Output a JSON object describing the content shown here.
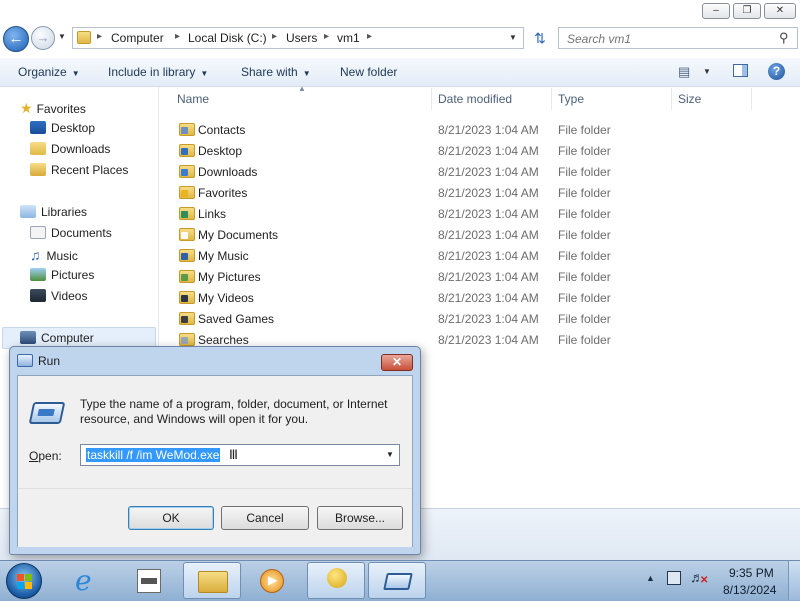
{
  "explorer": {
    "breadcrumb": [
      "Computer",
      "Local Disk (C:)",
      "Users",
      "vm1"
    ],
    "search_placeholder": "Search vm1",
    "toolbar": {
      "organize": "Organize",
      "include_in_library": "Include in library",
      "share_with": "Share with",
      "new_folder": "New folder"
    },
    "nav": {
      "favorites": "Favorites",
      "desktop": "Desktop",
      "downloads": "Downloads",
      "recent_places": "Recent Places",
      "libraries": "Libraries",
      "documents": "Documents",
      "music": "Music",
      "pictures": "Pictures",
      "videos": "Videos",
      "computer": "Computer"
    },
    "columns": {
      "name": "Name",
      "date_modified": "Date modified",
      "type": "Type",
      "size": "Size"
    },
    "files": [
      {
        "name": "Contacts",
        "date": "8/21/2023 1:04 AM",
        "type": "File folder"
      },
      {
        "name": "Desktop",
        "date": "8/21/2023 1:04 AM",
        "type": "File folder"
      },
      {
        "name": "Downloads",
        "date": "8/21/2023 1:04 AM",
        "type": "File folder"
      },
      {
        "name": "Favorites",
        "date": "8/21/2023 1:04 AM",
        "type": "File folder"
      },
      {
        "name": "Links",
        "date": "8/21/2023 1:04 AM",
        "type": "File folder"
      },
      {
        "name": "My Documents",
        "date": "8/21/2023 1:04 AM",
        "type": "File folder"
      },
      {
        "name": "My Music",
        "date": "8/21/2023 1:04 AM",
        "type": "File folder"
      },
      {
        "name": "My Pictures",
        "date": "8/21/2023 1:04 AM",
        "type": "File folder"
      },
      {
        "name": "My Videos",
        "date": "8/21/2023 1:04 AM",
        "type": "File folder"
      },
      {
        "name": "Saved Games",
        "date": "8/21/2023 1:04 AM",
        "type": "File folder"
      },
      {
        "name": "Searches",
        "date": "8/21/2023 1:04 AM",
        "type": "File folder"
      }
    ]
  },
  "run_dialog": {
    "title": "Run",
    "description": "Type the name of a program, folder, document, or Internet resource, and Windows will open it for you.",
    "open_label": "Open:",
    "open_value": "taskkill /f /im WeMod.exe",
    "ok": "OK",
    "cancel": "Cancel",
    "browse": "Browse..."
  },
  "taskbar": {
    "time": "9:35 PM",
    "date": "8/13/2024"
  },
  "colors": {
    "toolbar_text": "#1e3957",
    "selection": "#3399ff",
    "taskbar": "#a9c2de"
  }
}
